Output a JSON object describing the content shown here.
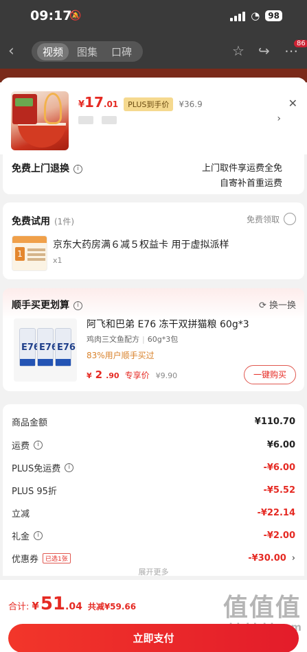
{
  "status_bar": {
    "time": "09:17",
    "battery": "98",
    "mute_icon": "bell-slash-icon",
    "wifi_icon": "wifi-icon"
  },
  "nav": {
    "tabs": [
      {
        "label": "视频",
        "active": true
      },
      {
        "label": "图集",
        "active": false
      },
      {
        "label": "口碑",
        "active": false
      }
    ],
    "badge": "86"
  },
  "product": {
    "price_currency": "¥",
    "price_int": "17",
    "price_dec": ".01",
    "plus_label": "PLUS到手价",
    "original_price": "¥36.9"
  },
  "return_service": {
    "title": "免费上门退换",
    "desc_line1": "上门取件享运费全免",
    "desc_line2": "自寄补首重运费"
  },
  "trial": {
    "title": "免费试用",
    "count": "(1件)",
    "claim_label": "免费领取",
    "item_name": "京东大药房满６减５权益卡 用于虚拟派样",
    "item_qty": "x1"
  },
  "addon": {
    "title": "顺手买更划算",
    "swap_label": "换一换",
    "item_name": "阿飞和巴弟 E76 冻干双拼猫粮 60g*3",
    "spec_flavor": "鸡肉三文鱼配方",
    "spec_size": "60g*3包",
    "popularity": "83%用户顺手买过",
    "price_currency": "¥",
    "price_int": "2",
    "price_dec": ".90",
    "price_label": "专享价",
    "original_price": "¥9.90",
    "buy_label": "一键购买",
    "bag_label": "E76"
  },
  "summary": {
    "rows": [
      {
        "label": "商品金额",
        "value": "¥110.70",
        "info": false,
        "negative": false
      },
      {
        "label": "运费",
        "value": "¥6.00",
        "info": true,
        "negative": false
      },
      {
        "label": "PLUS免运费",
        "value": "-¥6.00",
        "info": true,
        "negative": true
      },
      {
        "label": "PLUS 95折",
        "value": "-¥5.52",
        "info": false,
        "negative": true
      },
      {
        "label": "立减",
        "value": "-¥22.14",
        "info": false,
        "negative": true
      },
      {
        "label": "礼金",
        "value": "-¥2.00",
        "info": true,
        "negative": true
      },
      {
        "label": "优惠券",
        "value": "-¥30.00",
        "info": false,
        "negative": true,
        "tag": "已选1张"
      }
    ],
    "expand_label": "展开更多"
  },
  "checkout": {
    "total_label": "合计:",
    "currency": "¥",
    "total_int": "51",
    "total_dec": ".04",
    "saved_label": "共减¥59.66",
    "pay_label": "立即支付"
  },
  "watermark": {
    "big": "值值值",
    "small": "zhizhizhi.com"
  },
  "colors": {
    "accent": "#e52a23",
    "plus_gold": "#f5d98f",
    "popularity": "#d9822b"
  }
}
